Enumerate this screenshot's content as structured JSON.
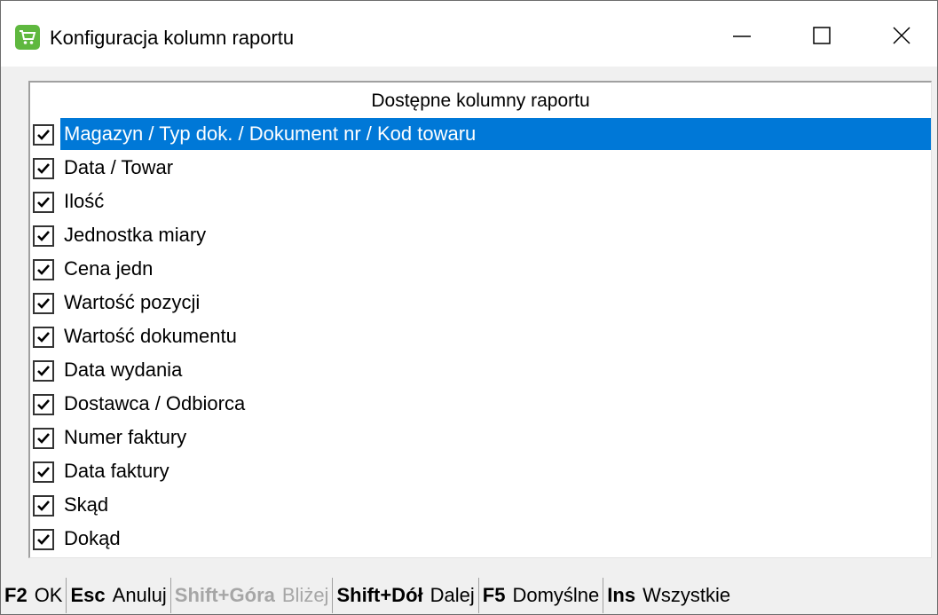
{
  "window": {
    "title": "Konfiguracja kolumn raportu",
    "app_icon": "shopping-cart-icon",
    "accent": "#0078d7"
  },
  "list": {
    "header": "Dostępne kolumny raportu",
    "items": [
      {
        "label": "Magazyn / Typ dok. / Dokument nr / Kod towaru",
        "checked": true,
        "selected": true
      },
      {
        "label": "Data / Towar",
        "checked": true,
        "selected": false
      },
      {
        "label": "Ilość",
        "checked": true,
        "selected": false
      },
      {
        "label": "Jednostka miary",
        "checked": true,
        "selected": false
      },
      {
        "label": "Cena jedn",
        "checked": true,
        "selected": false
      },
      {
        "label": "Wartość pozycji",
        "checked": true,
        "selected": false
      },
      {
        "label": "Wartość dokumentu",
        "checked": true,
        "selected": false
      },
      {
        "label": "Data wydania",
        "checked": true,
        "selected": false
      },
      {
        "label": "Dostawca / Odbiorca",
        "checked": true,
        "selected": false
      },
      {
        "label": "Numer faktury",
        "checked": true,
        "selected": false
      },
      {
        "label": "Data faktury",
        "checked": true,
        "selected": false
      },
      {
        "label": "Skąd",
        "checked": true,
        "selected": false
      },
      {
        "label": "Dokąd",
        "checked": true,
        "selected": false
      }
    ]
  },
  "shortcuts": [
    {
      "key": "F2",
      "label": "OK",
      "enabled": true
    },
    {
      "key": "Esc",
      "label": "Anuluj",
      "enabled": true
    },
    {
      "key": "Shift+Góra",
      "label": "Bliżej",
      "enabled": false
    },
    {
      "key": "Shift+Dół",
      "label": "Dalej",
      "enabled": true
    },
    {
      "key": "F5",
      "label": "Domyślne",
      "enabled": true
    },
    {
      "key": "Ins",
      "label": "Wszystkie",
      "enabled": true
    }
  ]
}
